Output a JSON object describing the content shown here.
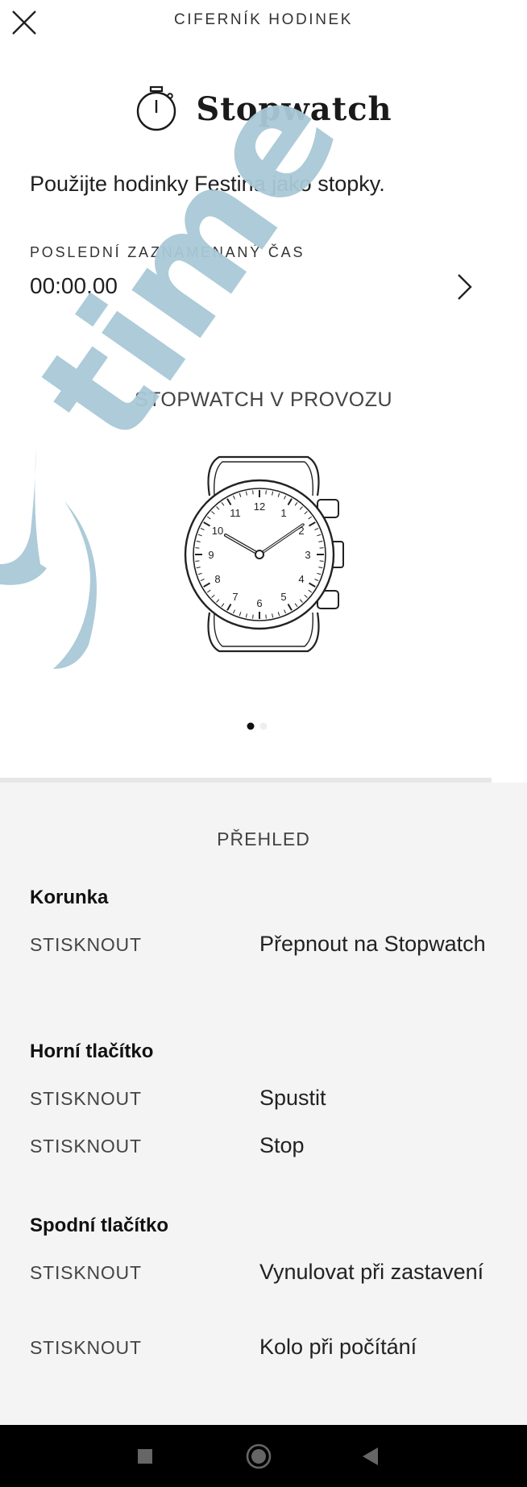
{
  "header": {
    "title": "CIFERNÍK HODINEK",
    "close_icon": "close-icon"
  },
  "main": {
    "title": "Stopwatch",
    "title_icon": "stopwatch-icon",
    "description": "Použijte hodinky Festina jako stopky.",
    "last_time_label": "POSLEDNÍ ZAZNAMENANÝ ČAS",
    "last_time_value": "00:00,00",
    "running_label": "STOPWATCH V PROVOZU",
    "watch_numbers": [
      "12",
      "1",
      "2",
      "3",
      "4",
      "5",
      "6",
      "7",
      "8",
      "9",
      "10",
      "11"
    ],
    "carousel": {
      "pages": 2,
      "active": 1
    }
  },
  "overview": {
    "title": "PŘEHLED",
    "sections": [
      {
        "title": "Korunka",
        "actions": [
          {
            "label": "STISKNOUT",
            "desc": "Přepnout na Stopwatch"
          }
        ]
      },
      {
        "title": "Horní tlačítko",
        "actions": [
          {
            "label": "STISKNOUT",
            "desc": "Spustit"
          },
          {
            "label": "STISKNOUT",
            "desc": "Stop"
          }
        ]
      },
      {
        "title": "Spodní tlačítko",
        "actions": [
          {
            "label": "STISKNOUT",
            "desc": "Vynulovat při zastavení"
          },
          {
            "label": "STISKNOUT",
            "desc": "Kolo při počítání"
          }
        ]
      }
    ]
  },
  "watermark": {
    "text": "time",
    "color": "#a9c8d6"
  },
  "navbar": {
    "icons": [
      "recent-apps-icon",
      "home-icon",
      "back-icon"
    ]
  }
}
